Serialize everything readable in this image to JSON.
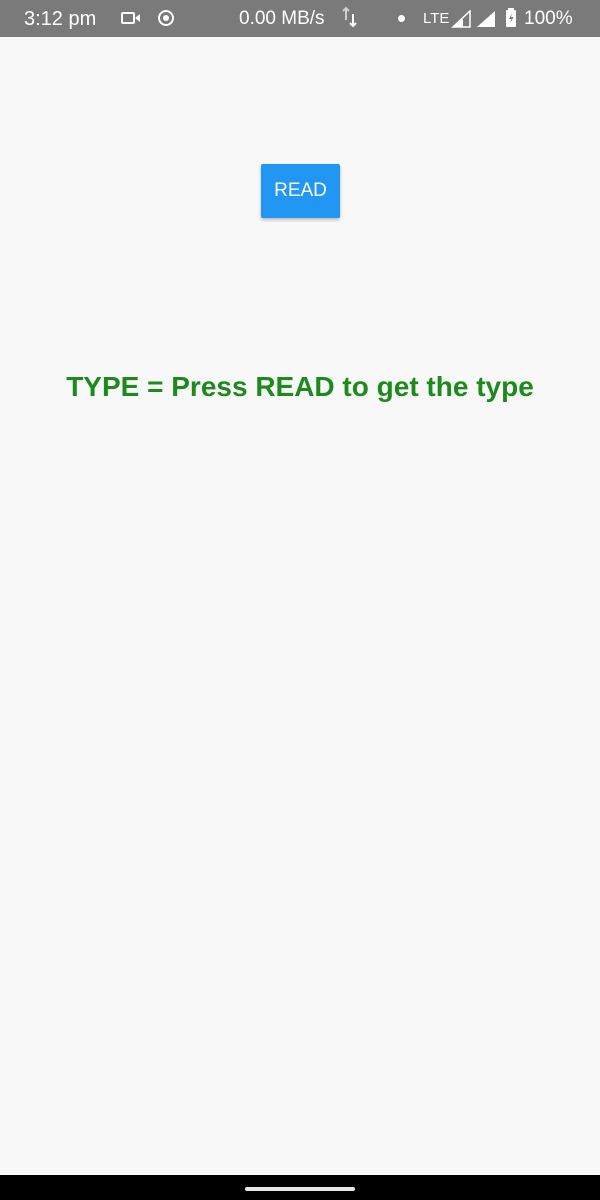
{
  "status_bar": {
    "time": "3:12 pm",
    "network_speed": "0.00 MB/s",
    "network_type": "LTE",
    "battery": "100%",
    "icons": [
      "camera-icon",
      "record-icon",
      "updown-arrows-icon",
      "dot-icon",
      "signal-icon",
      "signal-icon",
      "battery-icon"
    ]
  },
  "main": {
    "read_button_label": "READ",
    "type_text": "TYPE = Press READ to get the type"
  },
  "colors": {
    "status_bar_bg": "#7a7a7a",
    "background": "#f8f8f8",
    "button_bg": "#2196f3",
    "type_text_color": "#1e8a1e",
    "nav_bar_bg": "#000000"
  }
}
